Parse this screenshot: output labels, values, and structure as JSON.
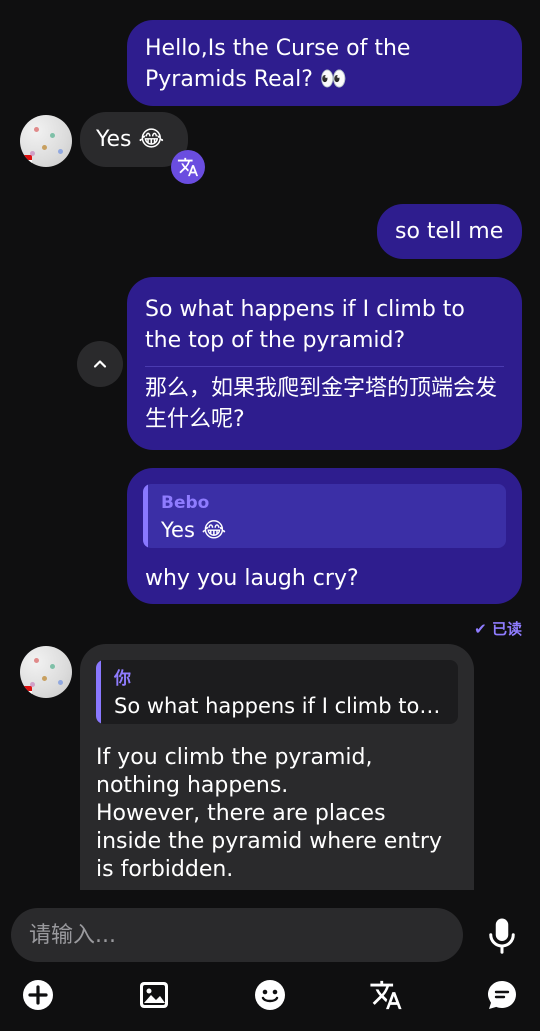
{
  "messages": {
    "m1": {
      "text": "Hello,Is the Curse of the Pyramids Real?  👀"
    },
    "m2": {
      "text": "Yes 😂"
    },
    "m3": {
      "text": "so tell me"
    },
    "m4": {
      "text": "So what happens if I climb to the top of the pyramid?",
      "translation": "那么，如果我爬到金字塔的顶端会发生什么呢?"
    },
    "m5": {
      "quote_name": "Bebo",
      "quote_text": "Yes 😂",
      "text": "why you laugh cry?"
    },
    "m6": {
      "quote_name": "你",
      "quote_text": "So what happens if I climb to th...",
      "text_line1": "If you climb the pyramid,",
      "text_line2": "nothing happens.",
      "text_line3": "However, there are places",
      "text_line4": "inside the pyramid where entry",
      "text_line5": "is forbidden."
    }
  },
  "read_receipt": "已读",
  "input": {
    "placeholder": "请输入..."
  },
  "icons": {
    "translate": "translate-icon",
    "collapse": "chevron-up-icon",
    "mic": "microphone-icon",
    "add": "plus-circle-icon",
    "image": "image-icon",
    "emoji": "emoji-icon",
    "translate_tool": "translate-icon",
    "quick_reply": "chat-bubble-icon"
  },
  "colors": {
    "accent": "#2e1d8e",
    "badge": "#6a4de0",
    "quote_name": "#8f7cff",
    "incoming": "#2a2a2c",
    "background": "#0f0f10"
  }
}
